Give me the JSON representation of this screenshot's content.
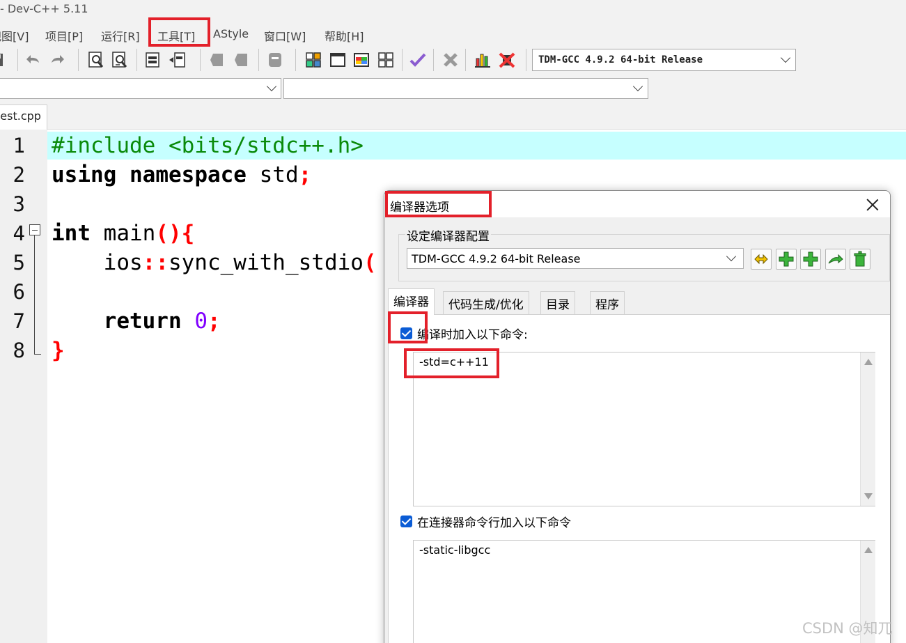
{
  "window": {
    "title": "- Dev-C++ 5.11"
  },
  "menu": {
    "items": [
      {
        "label": "视图[V]"
      },
      {
        "label": "项目[P]"
      },
      {
        "label": "运行[R]"
      },
      {
        "label": "工具[T]"
      },
      {
        "label": "AStyle"
      },
      {
        "label": "窗口[W]"
      },
      {
        "label": "帮助[H]"
      }
    ]
  },
  "toolbar": {
    "icons": [
      "save-icon",
      "undo-icon",
      "redo-icon",
      "find-icon",
      "replace-icon",
      "indent-icon",
      "unindent-icon",
      "bookmark-prev-icon",
      "bookmark-next-icon",
      "toggle-comment-icon",
      "new-project-icon",
      "window-icon",
      "class-browser-icon",
      "grid-icon",
      "check-syntax-icon",
      "delete-icon",
      "chart-icon",
      "debug-icon"
    ],
    "compiler_selected": "TDM-GCC 4.9.2 64-bit Release"
  },
  "editor": {
    "tab_label": "test.cpp",
    "line_numbers": [
      "1",
      "2",
      "3",
      "4",
      "5",
      "6",
      "7",
      "8"
    ],
    "lines": {
      "l1": "#include <bits/stdc++.h>",
      "l2_kw1": "using",
      "l2_kw2": "namespace",
      "l2_rest": " std",
      "l2_semi": ";",
      "l4_kw": "int",
      "l4_rest": " main",
      "l4_punc": "(){",
      "l5_a": "    ios",
      "l5_colons": "::",
      "l5_b": "sync_with_stdio",
      "l5_paren": "(",
      "l7_kw": "    return",
      "l7_num": "0",
      "l7_semi": ";",
      "l8": "}"
    }
  },
  "dialog": {
    "title": "编译器选项",
    "config_group_label": "设定编译器配置",
    "config_selected": "TDM-GCC 4.9.2 64-bit Release",
    "tabs": [
      "编译器",
      "代码生成/优化",
      "目录",
      "程序"
    ],
    "compiler_cmd_label": "编译时加入以下命令:",
    "compiler_cmd_value": "-std=c++11",
    "compiler_cmd_checked": true,
    "linker_cmd_label": "在连接器命令行加入以下命令",
    "linker_cmd_value": "-static-libgcc",
    "linker_cmd_checked": true
  },
  "colors": {
    "annotation": "#e3202a",
    "active_line": "#c6ffff",
    "preprocessor": "#0a8a0a",
    "punctuation": "#ff0000",
    "number": "#8000ff",
    "checkbox": "#0b5cd5"
  },
  "watermark": "CSDN @知兀"
}
